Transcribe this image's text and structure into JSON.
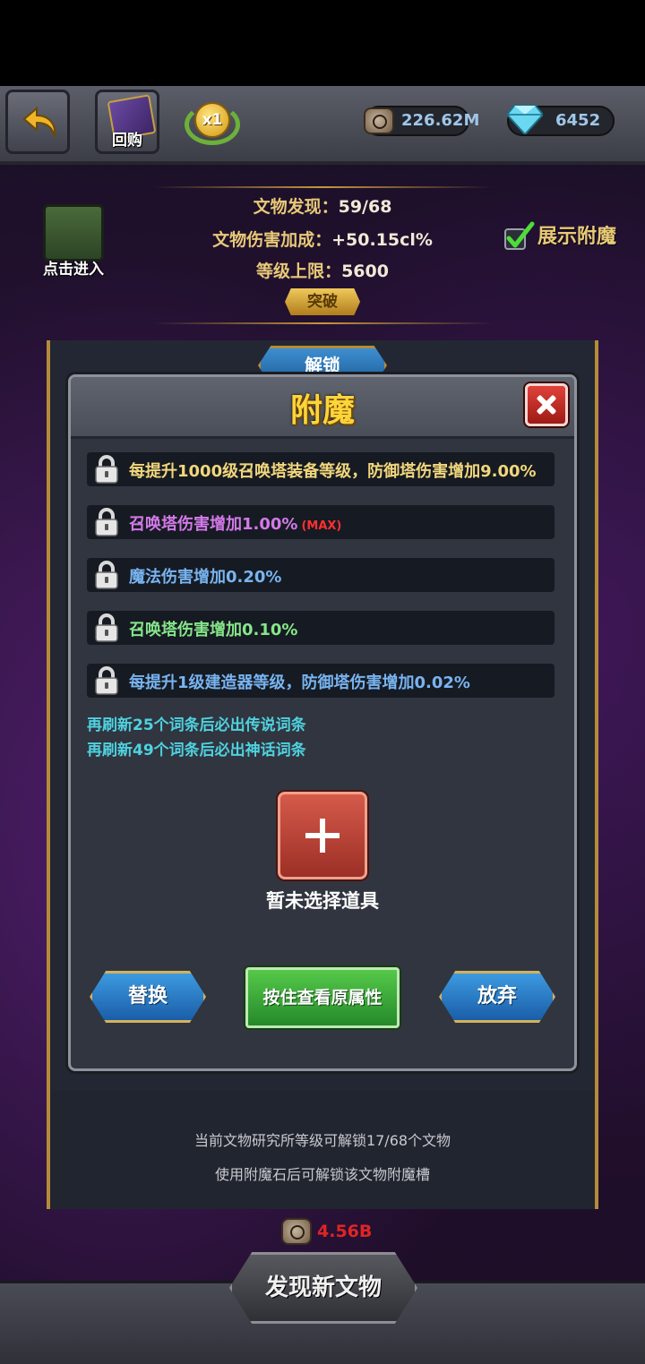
{
  "topbar": {
    "back_label": "",
    "buyback_label": "回购",
    "speed_label": "x1",
    "stone_amount": "226.62M",
    "gem_amount": "6452"
  },
  "header": {
    "artifacts_found_label": "文物发现：",
    "artifacts_found_value": "59/68",
    "damage_bonus_label": "文物伤害加成：",
    "damage_bonus_value": "+50.15cl%",
    "level_cap_label": "等级上限：",
    "level_cap_value": "5600",
    "breakthrough_label": "突破",
    "enter_label": "点击进入",
    "show_enchant_label": "展示附魔"
  },
  "frame": {
    "unlock_label": "解锁",
    "unlock_info": "当前文物研究所等级可解锁17/68个文物",
    "enchant_info": "使用附魔石后可解锁该文物附魔槽",
    "cost": "4.56B"
  },
  "dialog": {
    "title": "附魔",
    "affixes": [
      {
        "text": "每提升1000级召唤塔装备等级，防御塔伤害增加9.00%",
        "color": "#f1d77c",
        "max": ""
      },
      {
        "text": "召唤塔伤害增加1.00%",
        "color": "#d27ae8",
        "max": "(MAX)"
      },
      {
        "text": "魔法伤害增加0.20%",
        "color": "#78b4f0",
        "max": ""
      },
      {
        "text": "召唤塔伤害增加0.10%",
        "color": "#86e68a",
        "max": ""
      },
      {
        "text": "每提升1级建造器等级，防御塔伤害增加0.02%",
        "color": "#78b4f0",
        "max": ""
      }
    ],
    "refresh_legendary": "再刷新25个词条后必出传说词条",
    "refresh_mythic": "再刷新49个词条后必出神话词条",
    "no_item_label": "暂未选择道具",
    "replace_label": "替换",
    "hold_view_label": "按住查看原属性",
    "abandon_label": "放弃"
  },
  "bottom": {
    "discover_label": "发现新文物"
  }
}
